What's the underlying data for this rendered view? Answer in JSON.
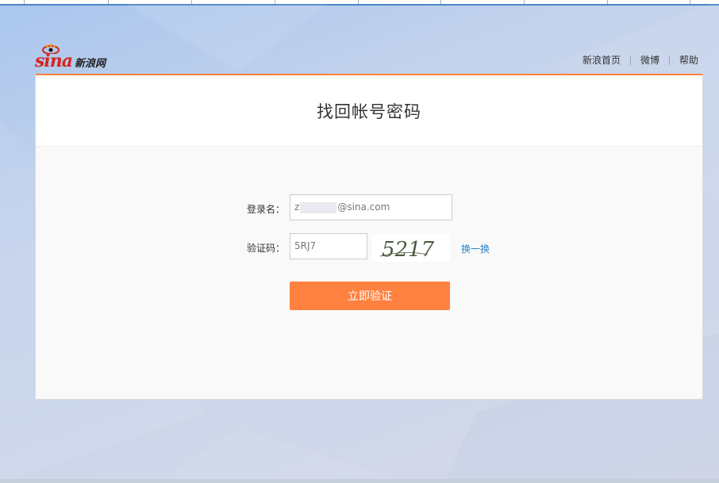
{
  "header": {
    "logo_text": "sina",
    "logo_sub": "新浪网",
    "nav": [
      "新浪首页",
      "微博",
      "帮助"
    ]
  },
  "panel": {
    "title": "找回帐号密码"
  },
  "form": {
    "username_label": "登录名：",
    "username_prefix": "z",
    "username_suffix": "@sina.com",
    "captcha_label": "验证码：",
    "captcha_value": "5RJ7",
    "captcha_image_text": "5217",
    "refresh_label": "换一换",
    "submit_label": "立即验证"
  },
  "colors": {
    "accent": "#ff8140",
    "link": "#2a82c4",
    "logo_red": "#d5261e"
  }
}
